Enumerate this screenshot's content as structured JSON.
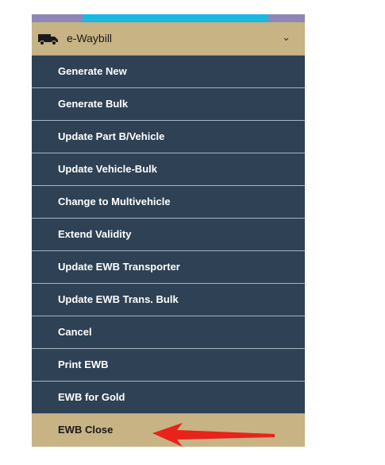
{
  "colors": {
    "menu_bg": "#2e4155",
    "accent_bg": "#c7b384",
    "strip_purple": "#8f86b8",
    "strip_cyan": "#1cb8e0",
    "arrow_red": "#e8231a"
  },
  "menu": {
    "title": "e-Waybill",
    "header_icon": "truck-icon",
    "expand_icon": "chevron-down-icon",
    "items": [
      "Generate New",
      "Generate Bulk",
      "Update Part B/Vehicle",
      "Update Vehicle-Bulk",
      "Change to Multivehicle",
      "Extend Validity",
      "Update EWB Transporter",
      "Update EWB Trans. Bulk",
      "Cancel",
      "Print EWB",
      "EWB for Gold",
      "EWB Close"
    ]
  },
  "annotation": {
    "icon": "red-arrow-icon",
    "points_to": "EWB Close"
  }
}
